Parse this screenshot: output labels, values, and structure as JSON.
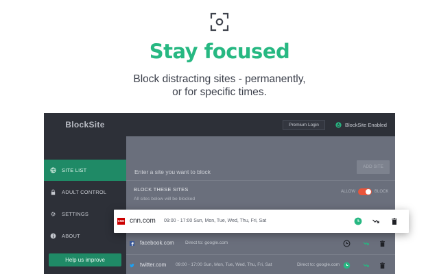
{
  "hero": {
    "icon": "focus-scan-icon",
    "title": "Stay focused",
    "subtitle_line1": "Block distracting sites - permanently,",
    "subtitle_line2": "or for specific times."
  },
  "app": {
    "brand": "BlockSite",
    "topbar": {
      "premium_login": "Premium Login",
      "status": "BlockSite Enabled",
      "status_icon": "power-icon"
    },
    "sidebar": {
      "items": [
        {
          "label": "SITE LIST",
          "icon": "globe-icon",
          "active": true
        },
        {
          "label": "ADULT CONTROL",
          "icon": "lock-icon",
          "active": false
        },
        {
          "label": "SETTINGS",
          "icon": "gear-icon",
          "active": false
        },
        {
          "label": "ABOUT",
          "icon": "info-icon",
          "active": false
        }
      ],
      "help_button": "Help us improve"
    },
    "main": {
      "input_placeholder": "Enter a site you want to block",
      "add_button": "ADD SITE",
      "block_title": "BLOCK THESE SITES",
      "block_subtitle": "All sites below will be blocked",
      "toggle": {
        "left_label": "ALLOW",
        "right_label": "BLOCK",
        "state": "block"
      }
    },
    "rows": [
      {
        "domain": "cnn.com",
        "times": "09:00 - 17:00   Sun, Mon, Tue, Wed, Thu, Fri, Sat",
        "favicon": "cnn-logo"
      },
      {
        "domain": "facebook.com",
        "direct": "Direct to:  google.com",
        "favicon": "facebook-logo"
      },
      {
        "domain": "twitter.com",
        "times": "09:00 - 17:00   Sun, Mon, Tue, Wed, Thu, Fri, Sat",
        "direct": "Direct to:  google.com",
        "favicon": "twitter-logo"
      }
    ]
  },
  "colors": {
    "brand_green": "#27b882",
    "accent_dark_green": "#1f8a66",
    "toggle_red": "#e9543a",
    "sidebar_bg": "#2d3038"
  }
}
